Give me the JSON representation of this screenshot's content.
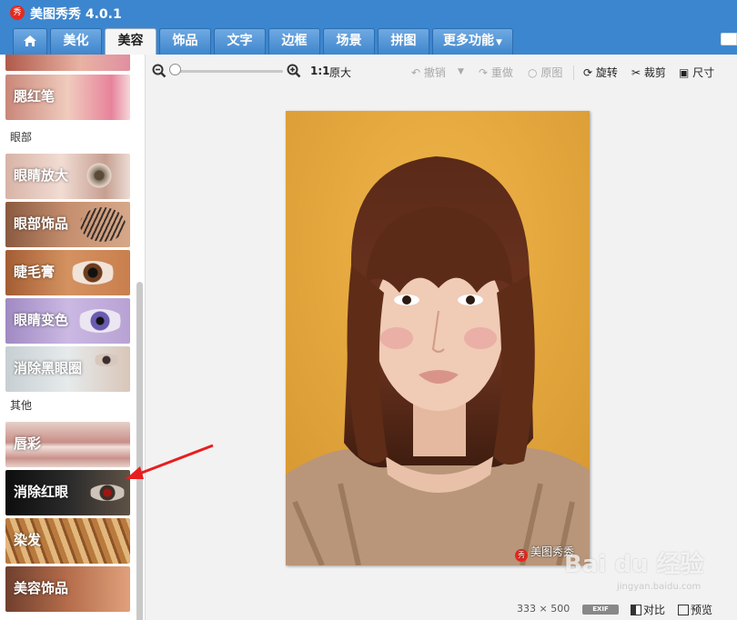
{
  "app": {
    "title": "美图秀秀 4.0.1",
    "logo_glyph": "秀"
  },
  "tabs": [
    {
      "label": ""
    },
    {
      "label": "美化"
    },
    {
      "label": "美容"
    },
    {
      "label": "饰品"
    },
    {
      "label": "文字"
    },
    {
      "label": "边框"
    },
    {
      "label": "场景"
    },
    {
      "label": "拼图"
    },
    {
      "label": "更多功能"
    }
  ],
  "sidebar": {
    "sections": [
      {
        "heading": "眼部"
      },
      {
        "heading": "其他"
      }
    ],
    "items": [
      {
        "label": "腮红笔"
      },
      {
        "label": "眼睛放大"
      },
      {
        "label": "眼部饰品"
      },
      {
        "label": "睫毛膏"
      },
      {
        "label": "眼睛变色"
      },
      {
        "label": "消除黑眼圈"
      },
      {
        "label": "唇彩"
      },
      {
        "label": "消除红眼"
      },
      {
        "label": "染发"
      },
      {
        "label": "美容饰品"
      }
    ]
  },
  "toolbar": {
    "ratio_label": "1:1",
    "original_size": "原大",
    "undo": "撤销",
    "redo": "重做",
    "original": "原图",
    "rotate": "旋转",
    "crop": "裁剪",
    "size": "尺寸"
  },
  "photo": {
    "watermark": "美图秀秀"
  },
  "status": {
    "width": "333",
    "times": "×",
    "height": "500",
    "exif": "EXIF",
    "compare": "对比",
    "preview": "预览"
  },
  "overlay": {
    "watermark": "Bai du 经验",
    "watermark_sub": "jingyan.baidu.com"
  },
  "colors": {
    "titlebar": "#3c86cf",
    "accent_red": "#e52a1f"
  }
}
